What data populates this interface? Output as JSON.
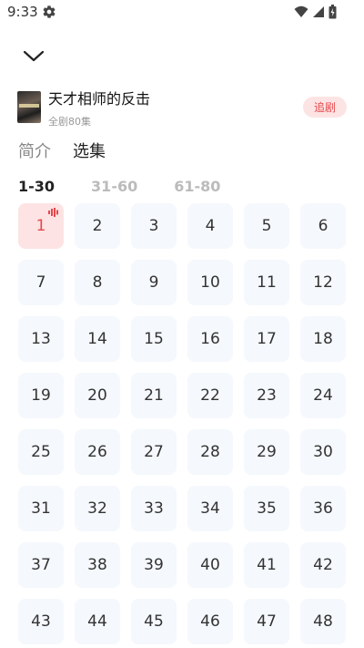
{
  "status_bar": {
    "time": "9:33"
  },
  "drama": {
    "title": "天才相师的反击",
    "subtitle": "全剧80集",
    "follow_label": "追剧"
  },
  "tabs": [
    {
      "label": "简介",
      "active": false
    },
    {
      "label": "选集",
      "active": true
    }
  ],
  "ranges": [
    {
      "label": "1-30",
      "active": true
    },
    {
      "label": "31-60",
      "active": false
    },
    {
      "label": "61-80",
      "active": false
    }
  ],
  "episodes": [
    "1",
    "2",
    "3",
    "4",
    "5",
    "6",
    "7",
    "8",
    "9",
    "10",
    "11",
    "12",
    "13",
    "14",
    "15",
    "16",
    "17",
    "18",
    "19",
    "20",
    "21",
    "22",
    "23",
    "24",
    "25",
    "26",
    "27",
    "28",
    "29",
    "30",
    "31",
    "32",
    "33",
    "34",
    "35",
    "36",
    "37",
    "38",
    "39",
    "40",
    "41",
    "42",
    "43",
    "44",
    "45",
    "46",
    "47",
    "48"
  ],
  "current_episode": 1,
  "colors": {
    "accent": "#e5484d",
    "active_cell_bg": "#fde3e3",
    "cell_bg": "#f5f8fc"
  },
  "icons": {
    "status_settings": "gear-icon",
    "collapse": "chevron-down-icon",
    "playing": "sound-wave-icon",
    "wifi": "wifi-icon",
    "signal": "signal-icon",
    "battery": "battery-icon"
  }
}
